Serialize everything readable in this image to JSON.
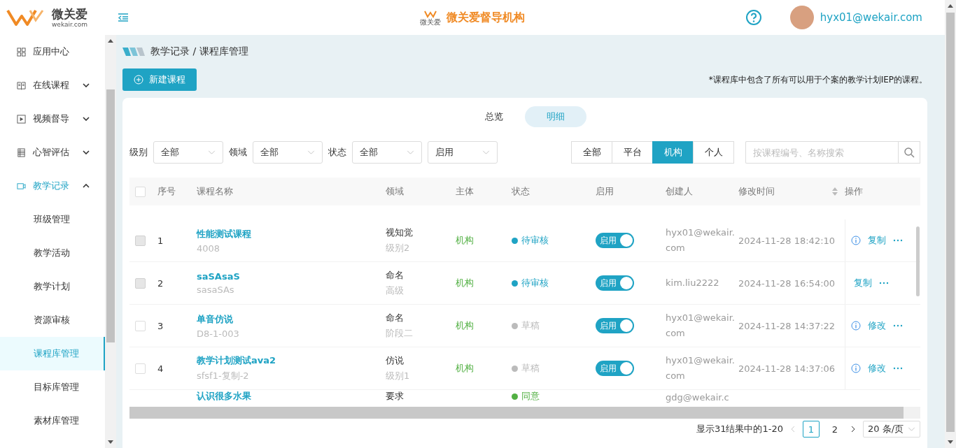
{
  "header": {
    "brand_name": "微关爱",
    "brand_domain": "wekair.com",
    "org_badge": "微关爱",
    "org_title": "微关爱督导机构",
    "user": "hyx01@wekair.com"
  },
  "sidebar": {
    "items": [
      {
        "label": "应用中心",
        "kind": "item"
      },
      {
        "label": "在线课程",
        "kind": "group",
        "expanded": false,
        "active": false
      },
      {
        "label": "视频督导",
        "kind": "group",
        "expanded": false,
        "active": false
      },
      {
        "label": "心智评估",
        "kind": "group",
        "expanded": false,
        "active": false
      },
      {
        "label": "教学记录",
        "kind": "group",
        "expanded": true,
        "active": true,
        "children": [
          {
            "label": "班级管理",
            "selected": false
          },
          {
            "label": "教学活动",
            "selected": false
          },
          {
            "label": "教学计划",
            "selected": false
          },
          {
            "label": "资源审核",
            "selected": false
          },
          {
            "label": "课程库管理",
            "selected": true
          },
          {
            "label": "目标库管理",
            "selected": false
          },
          {
            "label": "素材库管理",
            "selected": false
          }
        ]
      }
    ]
  },
  "breadcrumb": "教学记录 / 课程库管理",
  "new_button": "新建课程",
  "note": "*课程库中包含了所有可以用于个案的教学计划IEP的课程。",
  "view_tabs": [
    {
      "label": "总览",
      "selected": false
    },
    {
      "label": "明细",
      "selected": true
    }
  ],
  "filters": [
    {
      "label": "级别",
      "value": "全部"
    },
    {
      "label": "领域",
      "value": "全部"
    },
    {
      "label": "状态",
      "value": "全部"
    },
    {
      "value": "启用"
    }
  ],
  "scope_tabs": [
    {
      "label": "全部",
      "selected": false
    },
    {
      "label": "平台",
      "selected": false
    },
    {
      "label": "机构",
      "selected": true
    },
    {
      "label": "个人",
      "selected": false
    }
  ],
  "search": {
    "placeholder": "按课程编号、名称搜索"
  },
  "table": {
    "select_all_checked": false,
    "columns": [
      {
        "label": "序号",
        "sortable": false
      },
      {
        "label": "课程名称",
        "sortable": false
      },
      {
        "label": "领域",
        "sortable": false
      },
      {
        "label": "主体",
        "sortable": false
      },
      {
        "label": "状态",
        "sortable": false
      },
      {
        "label": "启用",
        "sortable": false
      },
      {
        "label": "创建人",
        "sortable": false
      },
      {
        "label": "修改时间",
        "sortable": true
      },
      {
        "label": "操作",
        "sortable": false
      }
    ],
    "rows": [
      {
        "kind": "full",
        "checkbox_disabled": true,
        "index": "1",
        "name": "性能测试课程",
        "code": "4008",
        "domain": "视知觉",
        "level": "级别2",
        "subject": "机构",
        "status": "待审核",
        "color": "#1fa3c4",
        "enabled": true,
        "toggle_label": "启用",
        "creator": "hyx01@wekair.com",
        "modified": "2024-11-28 18:42:10",
        "info": true,
        "action": "复制"
      },
      {
        "kind": "full",
        "checkbox_disabled": true,
        "index": "2",
        "name": "saSAsaS",
        "code": "sasaSAs",
        "domain": "命名",
        "level": "高级",
        "subject": "机构",
        "status": "待审核",
        "color": "#1fa3c4",
        "enabled": true,
        "toggle_label": "启用",
        "creator": "kim.liu2222",
        "modified": "2024-11-28 16:54:00",
        "info": false,
        "action": "复制"
      },
      {
        "kind": "full",
        "checkbox_disabled": false,
        "index": "3",
        "name": "单音仿说",
        "code": "D8-1-003",
        "domain": "命名",
        "level": "阶段二",
        "subject": "机构",
        "status": "草稿",
        "color": "#bbbbbb",
        "enabled": true,
        "toggle_label": "启用",
        "creator": "hyx01@wekair.com",
        "modified": "2024-11-28 14:37:22",
        "info": true,
        "action": "修改"
      },
      {
        "kind": "full",
        "checkbox_disabled": false,
        "index": "4",
        "name": "教学计划测试ava2",
        "code": "sfsf1-复制-2",
        "domain": "仿说",
        "level": "级别1",
        "subject": "机构",
        "status": "草稿",
        "color": "#bbbbbb",
        "enabled": true,
        "toggle_label": "启用",
        "creator": "hyx01@wekair.com",
        "modified": "2024-11-28 14:37:06",
        "info": true,
        "action": "修改"
      },
      {
        "kind": "partial",
        "name": "认识很多水果",
        "domain": "要求",
        "status": "同意",
        "color": "#52b043",
        "creator": "gdg@wekair.c"
      }
    ]
  },
  "pagination": {
    "summary": "显示31结果中的1-20",
    "pages": [
      {
        "label": "1",
        "selected": true
      },
      {
        "label": "2",
        "selected": false
      }
    ],
    "page_size": "20 条/页"
  }
}
